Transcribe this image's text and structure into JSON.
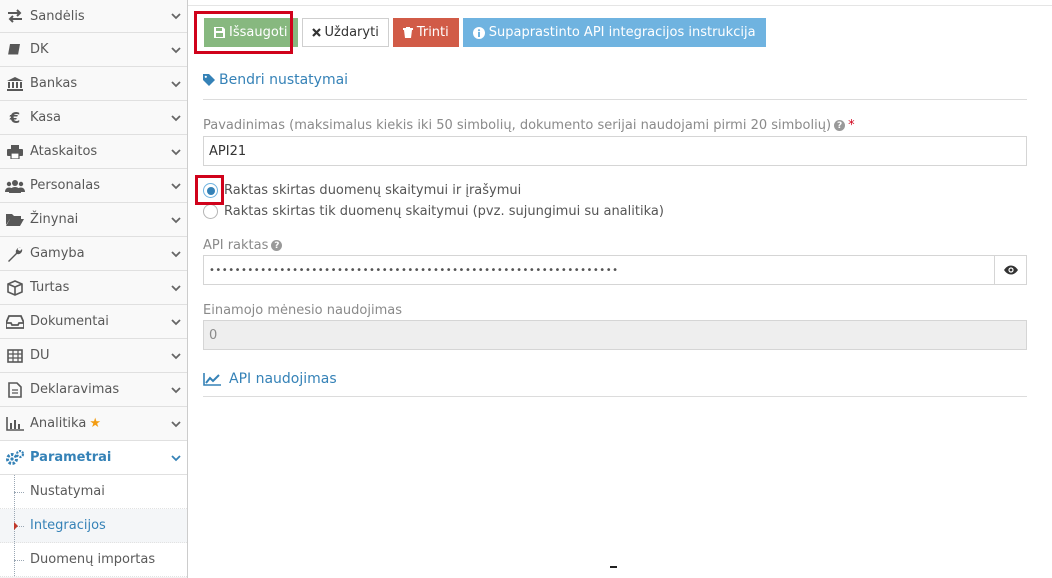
{
  "sidebar": {
    "items": [
      {
        "label": "Sandėlis",
        "icon": "exchange-icon"
      },
      {
        "label": "DK",
        "icon": "book-icon"
      },
      {
        "label": "Bankas",
        "icon": "bank-icon"
      },
      {
        "label": "Kasa",
        "icon": "euro-icon"
      },
      {
        "label": "Ataskaitos",
        "icon": "print-icon"
      },
      {
        "label": "Personalas",
        "icon": "users-icon"
      },
      {
        "label": "Žinynai",
        "icon": "folder-open-icon"
      },
      {
        "label": "Gamyba",
        "icon": "wrench-icon"
      },
      {
        "label": "Turtas",
        "icon": "cube-icon"
      },
      {
        "label": "Dokumentai",
        "icon": "inbox-icon"
      },
      {
        "label": "DU",
        "icon": "table-icon"
      },
      {
        "label": "Deklaravimas",
        "icon": "file-text-icon"
      },
      {
        "label": "Analitika",
        "icon": "bar-chart-icon"
      },
      {
        "label": "Parametrai",
        "icon": "cogs-icon"
      }
    ],
    "sub_items": [
      {
        "label": "Nustatymai"
      },
      {
        "label": "Integracijos"
      },
      {
        "label": "Duomenų importas"
      }
    ]
  },
  "toolbar": {
    "save_label": "Išsaugoti",
    "close_label": "Uždaryti",
    "delete_label": "Trinti",
    "instructions_label": "Supaprastinto API integracijos instrukcija"
  },
  "form": {
    "section_general": "Bendri nustatymai",
    "name_label": "Pavadinimas (maksimalus kiekis iki 50 simbolių, dokumento serijai naudojami pirmi 20 simbolių)",
    "name_value": "API21",
    "radio_readwrite": "Raktas skirtas duomenų skaitymui ir įrašymui",
    "radio_readonly": "Raktas skirtas tik duomenų skaitymui (pvz. sujungimui su analitika)",
    "api_key_label": "API raktas",
    "api_key_value": "••••••••••••••••••••••••••••••••••••••••••••••••••••••••••••••••",
    "usage_label": "Einamojo mėnesio naudojimas",
    "usage_value": "0",
    "section_usage": "API naudojimas"
  },
  "colors": {
    "accent": "#3582b7",
    "success": "#87b87f",
    "danger": "#d15b47",
    "info": "#6fb3e0",
    "highlight": "#d0021b"
  }
}
